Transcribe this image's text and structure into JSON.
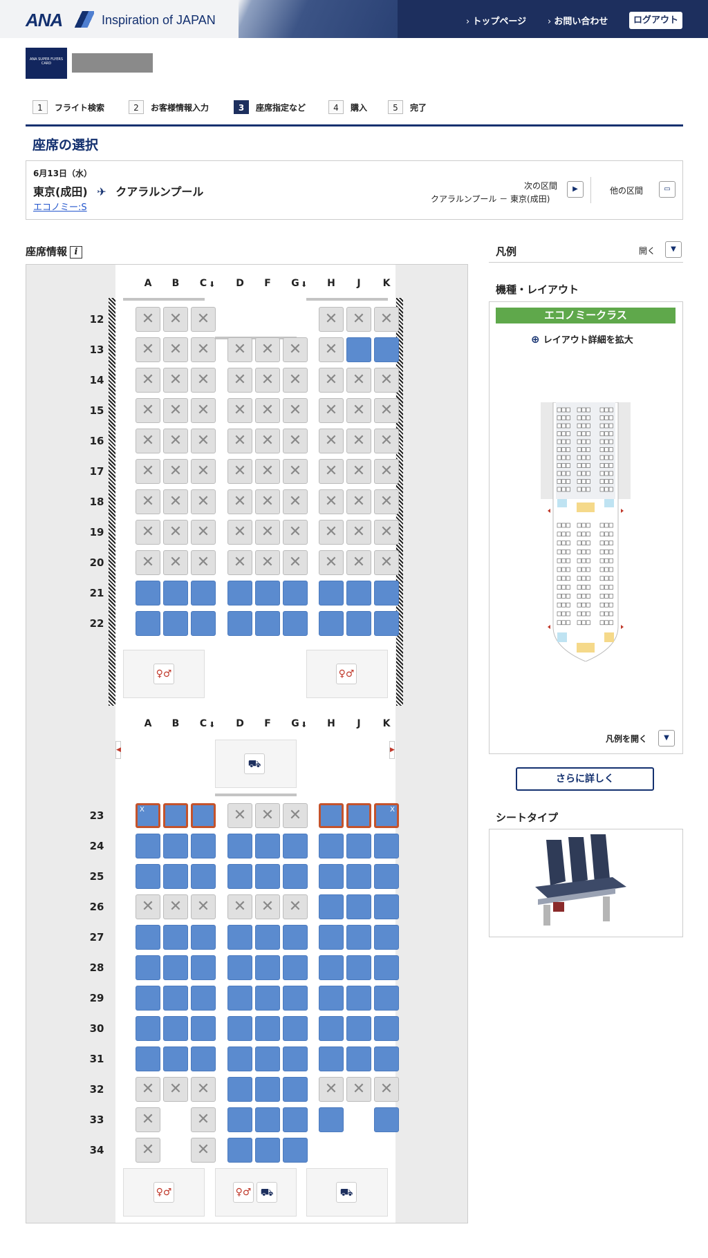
{
  "header": {
    "logo": "ANA",
    "tagline": "Inspiration of JAPAN",
    "nav": [
      "トップページ",
      "お問い合わせ"
    ],
    "logout": "ログアウト"
  },
  "card": {
    "label": "ANA SUPER FLYERS CARD"
  },
  "steps": [
    {
      "num": "1",
      "label": "フライト検索"
    },
    {
      "num": "2",
      "label": "お客様情報入力"
    },
    {
      "num": "3",
      "label": "座席指定など"
    },
    {
      "num": "4",
      "label": "購入"
    },
    {
      "num": "5",
      "label": "完了"
    }
  ],
  "active_step": 3,
  "page_title": "座席の選択",
  "flight": {
    "date": "6月13日（水）",
    "origin": "東京(成田)",
    "destination": "クアラルンプール",
    "plane_icon": "✈",
    "fare": "エコノミー:S",
    "next_label": "次の区間",
    "next_route": "クアラルンプール － 東京(成田)",
    "other_label": "他の区間"
  },
  "seat_info_title": "座席情報",
  "seat_info_icon": "i",
  "columns": [
    "A",
    "B",
    "C",
    "D",
    "F",
    "G",
    "H",
    "J",
    "K"
  ],
  "aisle_icon": "down-arrow-icon",
  "seat_legend": {
    "available": "#5b8bcf",
    "occupied": "#e0e0e0",
    "exit_row": "#c4532c"
  },
  "rows_front": [
    {
      "row": "12",
      "seats": [
        "o",
        "o",
        "o",
        "-",
        "-",
        "-",
        "o",
        "o",
        "o"
      ]
    },
    {
      "row": "13",
      "seats": [
        "o",
        "o",
        "o",
        "o",
        "o",
        "o",
        "o",
        "a",
        "a"
      ]
    },
    {
      "row": "14",
      "seats": [
        "o",
        "o",
        "o",
        "o",
        "o",
        "o",
        "o",
        "o",
        "o"
      ]
    },
    {
      "row": "15",
      "seats": [
        "o",
        "o",
        "o",
        "o",
        "o",
        "o",
        "o",
        "o",
        "o"
      ]
    },
    {
      "row": "16",
      "seats": [
        "o",
        "o",
        "o",
        "o",
        "o",
        "o",
        "o",
        "o",
        "o"
      ]
    },
    {
      "row": "17",
      "seats": [
        "o",
        "o",
        "o",
        "o",
        "o",
        "o",
        "o",
        "o",
        "o"
      ]
    },
    {
      "row": "18",
      "seats": [
        "o",
        "o",
        "o",
        "o",
        "o",
        "o",
        "o",
        "o",
        "o"
      ]
    },
    {
      "row": "19",
      "seats": [
        "o",
        "o",
        "o",
        "o",
        "o",
        "o",
        "o",
        "o",
        "o"
      ]
    },
    {
      "row": "20",
      "seats": [
        "o",
        "o",
        "o",
        "o",
        "o",
        "o",
        "o",
        "o",
        "o"
      ]
    },
    {
      "row": "21",
      "seats": [
        "a",
        "a",
        "a",
        "a",
        "a",
        "a",
        "a",
        "a",
        "a"
      ]
    },
    {
      "row": "22",
      "seats": [
        "a",
        "a",
        "a",
        "a",
        "a",
        "a",
        "a",
        "a",
        "a"
      ]
    }
  ],
  "rows_rear": [
    {
      "row": "23",
      "seats": [
        "e",
        "e",
        "e",
        "o",
        "o",
        "o",
        "e",
        "e",
        "e"
      ]
    },
    {
      "row": "24",
      "seats": [
        "a",
        "a",
        "a",
        "a",
        "a",
        "a",
        "a",
        "a",
        "a"
      ]
    },
    {
      "row": "25",
      "seats": [
        "a",
        "a",
        "a",
        "a",
        "a",
        "a",
        "a",
        "a",
        "a"
      ]
    },
    {
      "row": "26",
      "seats": [
        "o",
        "o",
        "o",
        "o",
        "o",
        "o",
        "a",
        "a",
        "a"
      ]
    },
    {
      "row": "27",
      "seats": [
        "a",
        "a",
        "a",
        "a",
        "a",
        "a",
        "a",
        "a",
        "a"
      ]
    },
    {
      "row": "28",
      "seats": [
        "a",
        "a",
        "a",
        "a",
        "a",
        "a",
        "a",
        "a",
        "a"
      ]
    },
    {
      "row": "29",
      "seats": [
        "a",
        "a",
        "a",
        "a",
        "a",
        "a",
        "a",
        "a",
        "a"
      ]
    },
    {
      "row": "30",
      "seats": [
        "a",
        "a",
        "a",
        "a",
        "a",
        "a",
        "a",
        "a",
        "a"
      ]
    },
    {
      "row": "31",
      "seats": [
        "a",
        "a",
        "a",
        "a",
        "a",
        "a",
        "a",
        "a",
        "a"
      ]
    },
    {
      "row": "32",
      "seats": [
        "o",
        "o",
        "o",
        "a",
        "a",
        "a",
        "o",
        "o",
        "o"
      ]
    },
    {
      "row": "33",
      "seats": [
        "o",
        "-",
        "o",
        "a",
        "a",
        "a",
        "a",
        "-",
        "a"
      ]
    },
    {
      "row": "34",
      "seats": [
        "o",
        "-",
        "o",
        "a",
        "a",
        "a",
        "-",
        "-",
        "-"
      ]
    }
  ],
  "exit_marks": {
    "23A": "X",
    "23K": "X"
  },
  "sidebar": {
    "legend_title": "凡例",
    "legend_open": "開く",
    "layout_title": "機種・レイアウト",
    "cabin_class": "エコノミークラス",
    "enlarge": "レイアウト詳細を拡大",
    "legend_open2": "凡例を開く",
    "more_detail": "さらに詳しく",
    "seat_type_title": "シートタイプ"
  }
}
